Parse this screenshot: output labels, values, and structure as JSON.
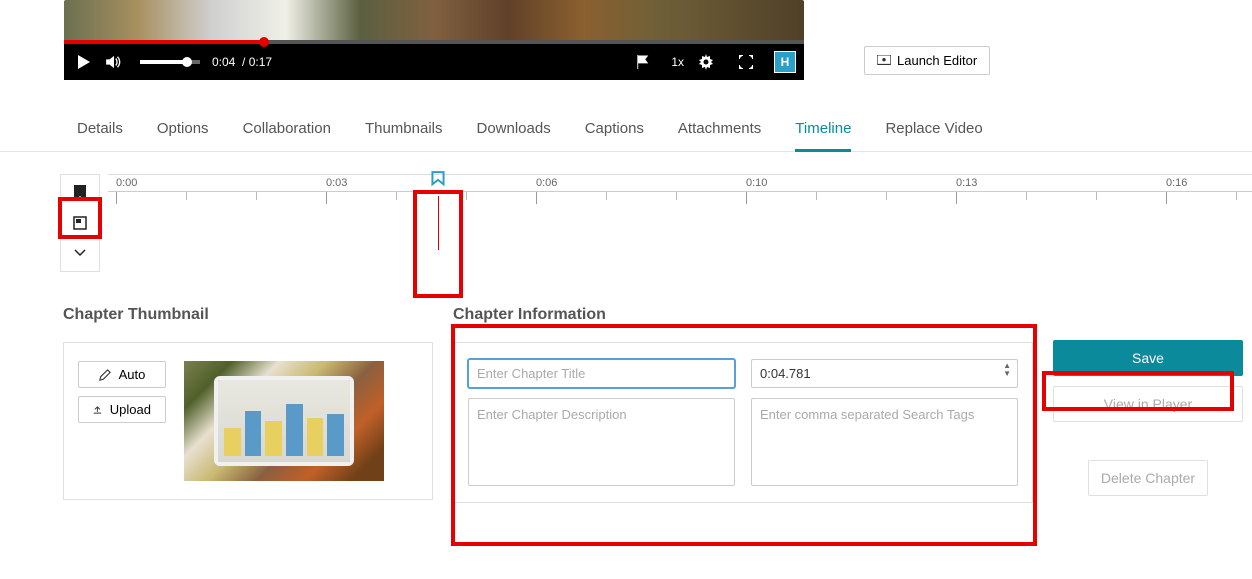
{
  "player": {
    "current_time": "0:04",
    "duration": "0:17",
    "speed": "1x",
    "brand": "H"
  },
  "launch_editor_label": "Launch Editor",
  "tabs": [
    "Details",
    "Options",
    "Collaboration",
    "Thumbnails",
    "Downloads",
    "Captions",
    "Attachments",
    "Timeline",
    "Replace Video"
  ],
  "active_tab": "Timeline",
  "timeline": {
    "labels": [
      "0:00",
      "0:03",
      "0:06",
      "0:10",
      "0:13",
      "0:16"
    ]
  },
  "chapter_thumbnail": {
    "title": "Chapter Thumbnail",
    "auto_label": "Auto",
    "upload_label": "Upload"
  },
  "chapter_info": {
    "title": "Chapter Information",
    "title_placeholder": "Enter Chapter Title",
    "desc_placeholder": "Enter Chapter Description",
    "time_value": "0:04.781",
    "tags_placeholder": "Enter comma separated Search Tags"
  },
  "actions": {
    "save": "Save",
    "view": "View in Player",
    "delete": "Delete Chapter"
  }
}
